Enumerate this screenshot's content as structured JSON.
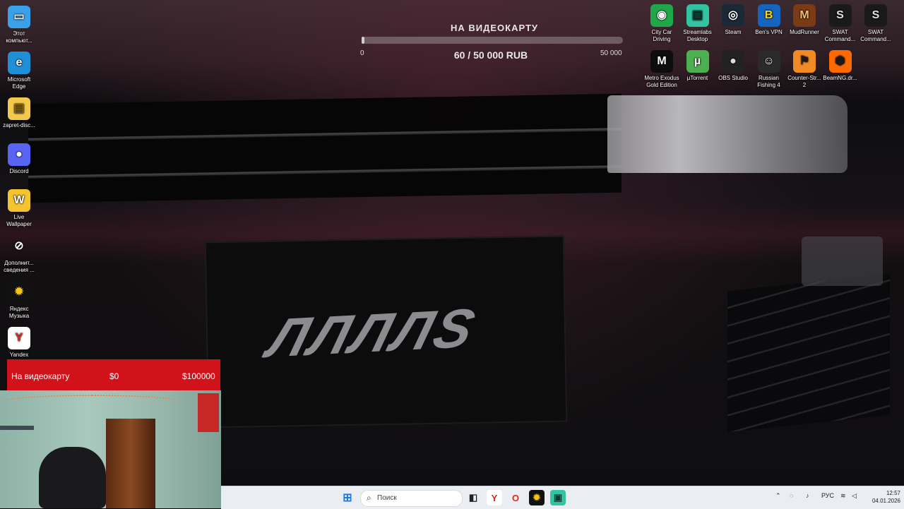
{
  "desktop_left_icons": [
    {
      "name": "this-pc-icon",
      "label": "Этот компьют...",
      "glyph": "▭",
      "bg": "#3aa0e8",
      "fg": "#ffffff"
    },
    {
      "name": "edge-icon",
      "label": "Microsoft Edge",
      "glyph": "e",
      "bg": "#1f8fd6",
      "fg": "#ffffff"
    },
    {
      "name": "folder-icon",
      "label": "zapret-disc...",
      "glyph": "▤",
      "bg": "#f2c94c",
      "fg": "#8a6a10"
    },
    {
      "name": "discord-icon",
      "label": "Discord",
      "glyph": "●",
      "bg": "#5865f2",
      "fg": "#ffffff"
    },
    {
      "name": "live-wallpaper-icon",
      "label": "Live Wallpaper",
      "glyph": "W",
      "bg": "#f4c430",
      "fg": "#ffffff"
    },
    {
      "name": "info-icon",
      "label": "Дополнит... сведения ...",
      "glyph": "⊘",
      "bg": "transparent",
      "fg": "#ffffff"
    },
    {
      "name": "yandex-music-icon",
      "label": "Яндекс Музыка",
      "glyph": "✹",
      "bg": "#111111",
      "fg": "#f5c518"
    },
    {
      "name": "yandex-icon",
      "label": "Yandex",
      "glyph": "Y",
      "bg": "#ffffff",
      "fg": "#e0261b"
    }
  ],
  "desktop_right_icons": [
    {
      "name": "city-car-driving-icon",
      "label": "City Car Driving",
      "glyph": "◉",
      "bg": "#1fa84a",
      "fg": "#ffffff"
    },
    {
      "name": "streamlabs-icon",
      "label": "Streamlabs Desktop",
      "glyph": "▣",
      "bg": "#31c3a2",
      "fg": "#0b3b30"
    },
    {
      "name": "steam-icon",
      "label": "Steam",
      "glyph": "◎",
      "bg": "#1b2838",
      "fg": "#ffffff"
    },
    {
      "name": "bens-vpn-icon",
      "label": "Ben's VPN",
      "glyph": "B",
      "bg": "#1565c0",
      "fg": "#ffd600"
    },
    {
      "name": "mudrunner-icon",
      "label": "MudRunner",
      "glyph": "M",
      "bg": "#7a3b16",
      "fg": "#f0c070"
    },
    {
      "name": "swat-icon",
      "label": "SWAT Command...",
      "glyph": "S",
      "bg": "#1a1a1a",
      "fg": "#e0e0e0"
    },
    {
      "name": "swat-icon-2",
      "label": "SWAT Command...",
      "glyph": "S",
      "bg": "#1a1a1a",
      "fg": "#e0e0e0"
    },
    {
      "name": "metro-exodus-icon",
      "label": "Metro Exodus Gold Edition",
      "glyph": "M",
      "bg": "#0d0d0d",
      "fg": "#ffffff"
    },
    {
      "name": "utorrent-icon",
      "label": "µTorrent",
      "glyph": "µ",
      "bg": "#4caf50",
      "fg": "#ffffff"
    },
    {
      "name": "obs-studio-icon",
      "label": "OBS Studio",
      "glyph": "●",
      "bg": "#222222",
      "fg": "#dddddd"
    },
    {
      "name": "russian-fishing-icon",
      "label": "Russian Fishing 4",
      "glyph": "☺",
      "bg": "#2a2a2a",
      "fg": "#ffffff"
    },
    {
      "name": "counter-strike-icon",
      "label": "Counter-Str... 2",
      "glyph": "⚑",
      "bg": "#f08a24",
      "fg": "#1a1a1a"
    },
    {
      "name": "beamng-icon",
      "label": "BeamNG.dr...",
      "glyph": "⬢",
      "bg": "#ff6a00",
      "fg": "#1a1a1a"
    }
  ],
  "donation_goal": {
    "title": "НА ВИДЕОКАРТУ",
    "min_label": "0",
    "max_label": "50 000",
    "amount_text": "60 / 50 000 RUB",
    "progress_fraction": 0.0012
  },
  "red_bar": {
    "title": "На видеокарту",
    "current": "$0",
    "target": "$100000"
  },
  "plate_text": "ЛЛЛЛS",
  "taskbar": {
    "search_placeholder": "Поиск",
    "language": "РУС",
    "time": "12:57",
    "date": "04.01.2026"
  }
}
